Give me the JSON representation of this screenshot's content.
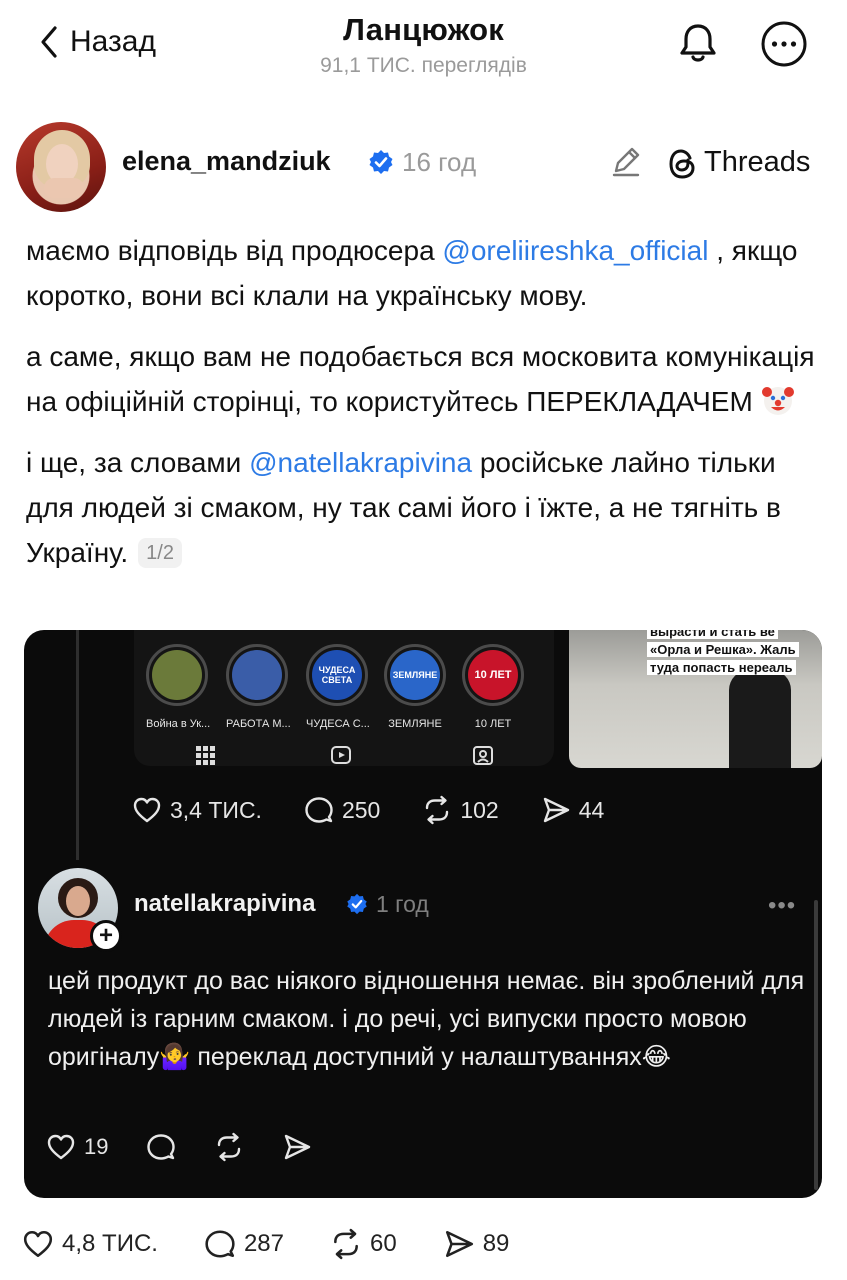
{
  "header": {
    "back_label": "Назад",
    "title": "Ланцюжок",
    "subtitle": "91,1 ТИС. переглядів"
  },
  "post": {
    "username": "elena_mandziuk",
    "time": "16 год",
    "platform_label": "Threads",
    "paragraphs": {
      "p1_a": "маємо відповідь від продюсера ",
      "p1_mention": "@oreliireshka_official",
      "p1_b": " , якщо коротко, вони всі клали на українську мову.",
      "p2": "а саме, якщо вам не подобається вся московита комунікація на офіційній сторінці, то користуйтесь ПЕРЕКЛАДАЧЕМ",
      "p3_a": "і ще, за словами ",
      "p3_mention": "@natellakrapivina",
      "p3_b": " російське лайно тільки для людей зі смаком, ну так самі його і їжте, а не тягніть в Україну.",
      "pager": "1/2"
    },
    "stats": {
      "likes": "4,8 ТИС.",
      "comments": "287",
      "reposts": "60",
      "shares": "89"
    }
  },
  "embed": {
    "stories": [
      {
        "label": "Война в Ук...",
        "inner": "",
        "color": "#6b7a3a"
      },
      {
        "label": "РАБОТА М...",
        "inner": "",
        "color": "#3a5da8"
      },
      {
        "label": "ЧУДЕСА С...",
        "inner": "ЧУДЕСА СВЕТА",
        "color": "#1e4fb3"
      },
      {
        "label": "ЗЕМЛЯНЕ",
        "inner": "ЗЕМЛЯНЕ",
        "color": "#2a66c9"
      },
      {
        "label": "10 ЛЕТ",
        "inner": "10 ЛЕТ",
        "color": "#c8142a"
      }
    ],
    "video_captions": [
      "вырасти и стать ве",
      "«Орла и Решка». Жаль",
      "туда попасть нереаль"
    ],
    "stats": {
      "likes": "3,4 ТИС.",
      "comments": "250",
      "reposts": "102",
      "shares": "44"
    },
    "reply": {
      "username": "natellakrapivina",
      "time": "1 год",
      "text": "цей продукт до вас ніякого відношення немає. він зроблений для людей із гарним смаком. і до речі, усі випуски просто мовою оригіналу🤷‍♀️ переклад доступний у налаштуваннях😂",
      "likes": "19"
    }
  },
  "colors": {
    "mention": "#2d7be5",
    "verified": "#1d6ef0",
    "muted": "#9a9a9a"
  }
}
